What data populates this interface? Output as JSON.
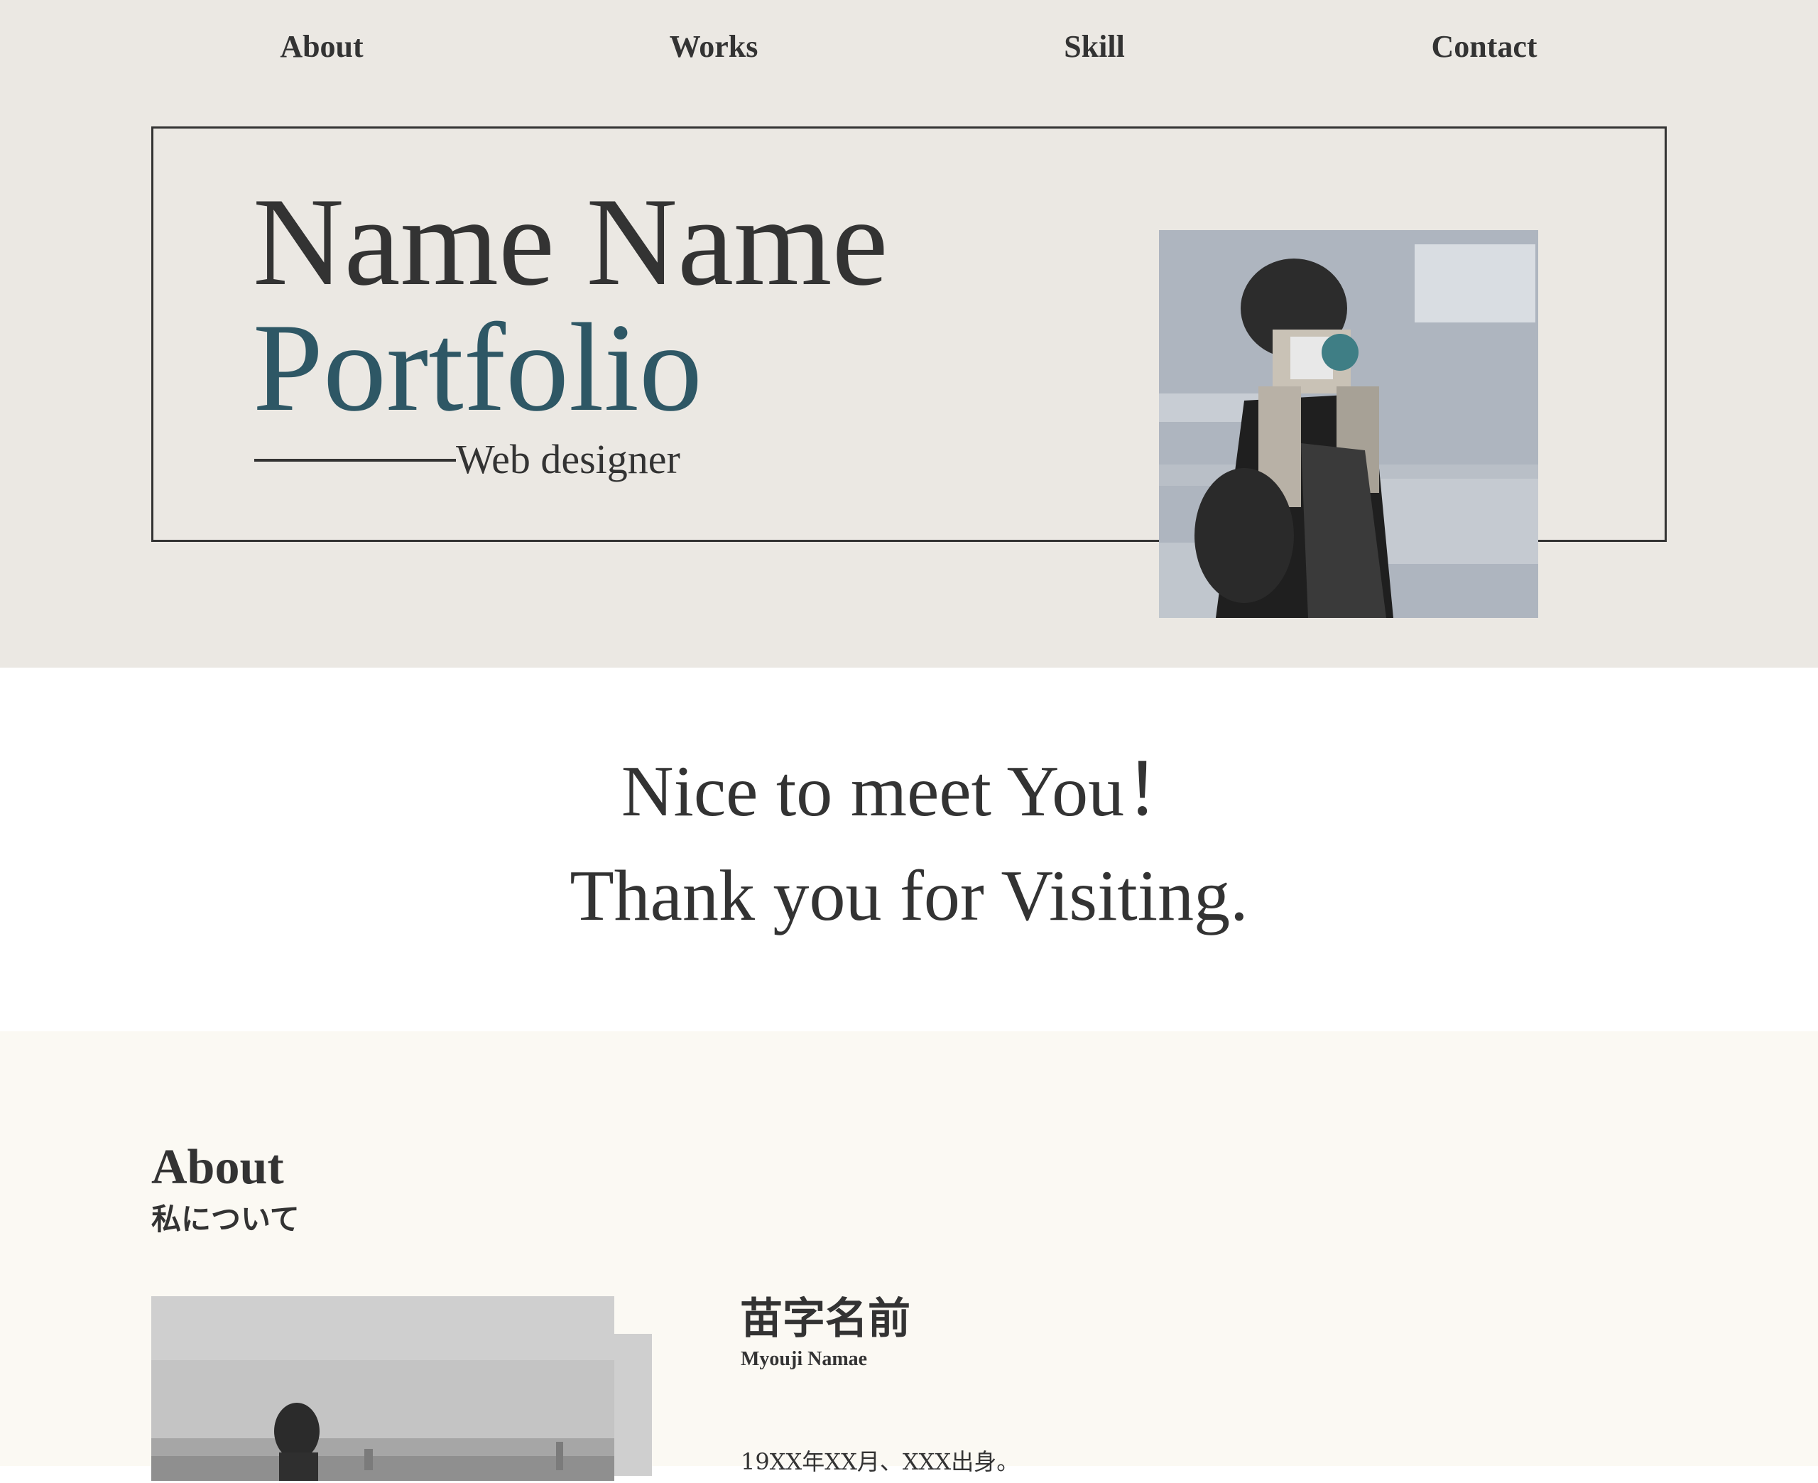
{
  "nav": {
    "items": [
      {
        "label": "About"
      },
      {
        "label": "Works"
      },
      {
        "label": "Skill"
      },
      {
        "label": "Contact"
      }
    ]
  },
  "hero": {
    "name": "Name Name",
    "portfolio": "Portfolio",
    "role": "Web designer"
  },
  "greeting": {
    "line1": "Nice to meet You！",
    "line2": "Thank you for Visiting."
  },
  "about": {
    "heading": "About",
    "subheading": "私について",
    "name_jp": "苗字名前",
    "name_en": "Myouji Namae",
    "bio_line1": "19XX年XX月、XXX出身。"
  },
  "colors": {
    "hero_bg": "#ebe8e3",
    "accent": "#2e5765",
    "text": "#333333",
    "about_bg": "#fbf9f3"
  }
}
